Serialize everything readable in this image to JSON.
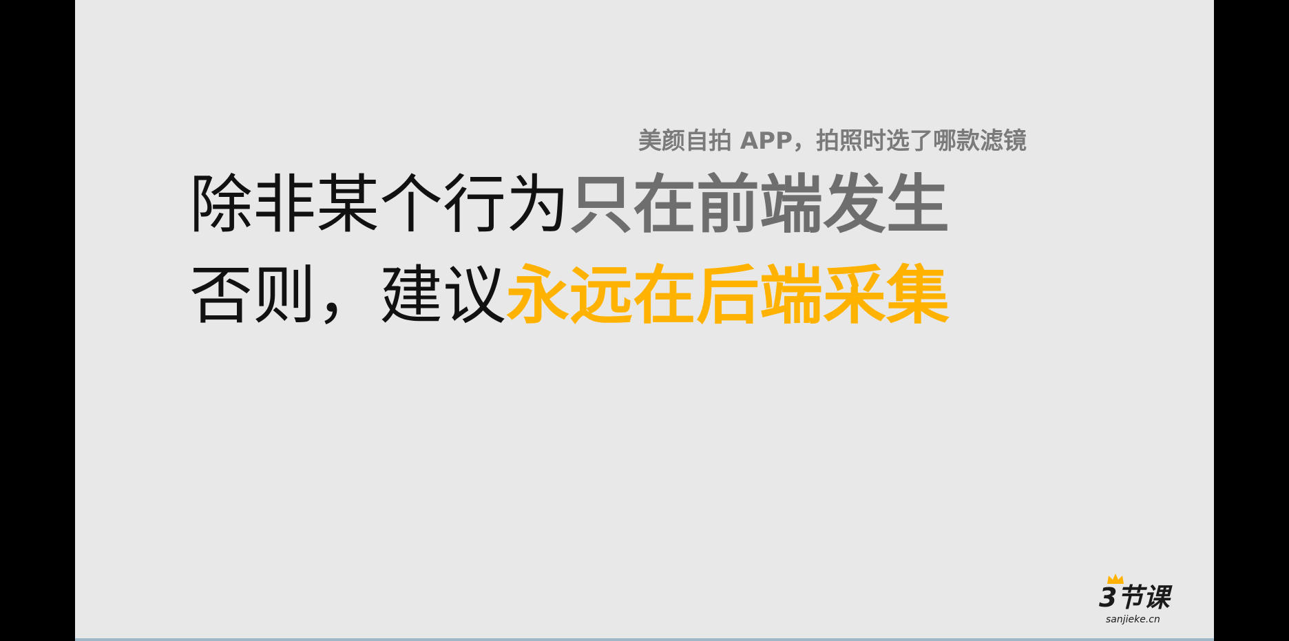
{
  "slide": {
    "subtitle": "美颜自拍 APP，拍照时选了哪款滤镜",
    "line1": {
      "plain": "除非某个行为",
      "highlight": "只在前端发生"
    },
    "line2": {
      "plain": "否则，建议",
      "highlight": "永远在后端采集"
    }
  },
  "logo": {
    "main": "3节课",
    "sub": "sanjieke.cn"
  },
  "colors": {
    "background": "#e8e8e8",
    "text": "#111111",
    "highlight_gray": "#6e6e6e",
    "highlight_orange": "#ffb300",
    "crown": "#ffb300"
  },
  "icons": {
    "crown": "crown-icon"
  }
}
